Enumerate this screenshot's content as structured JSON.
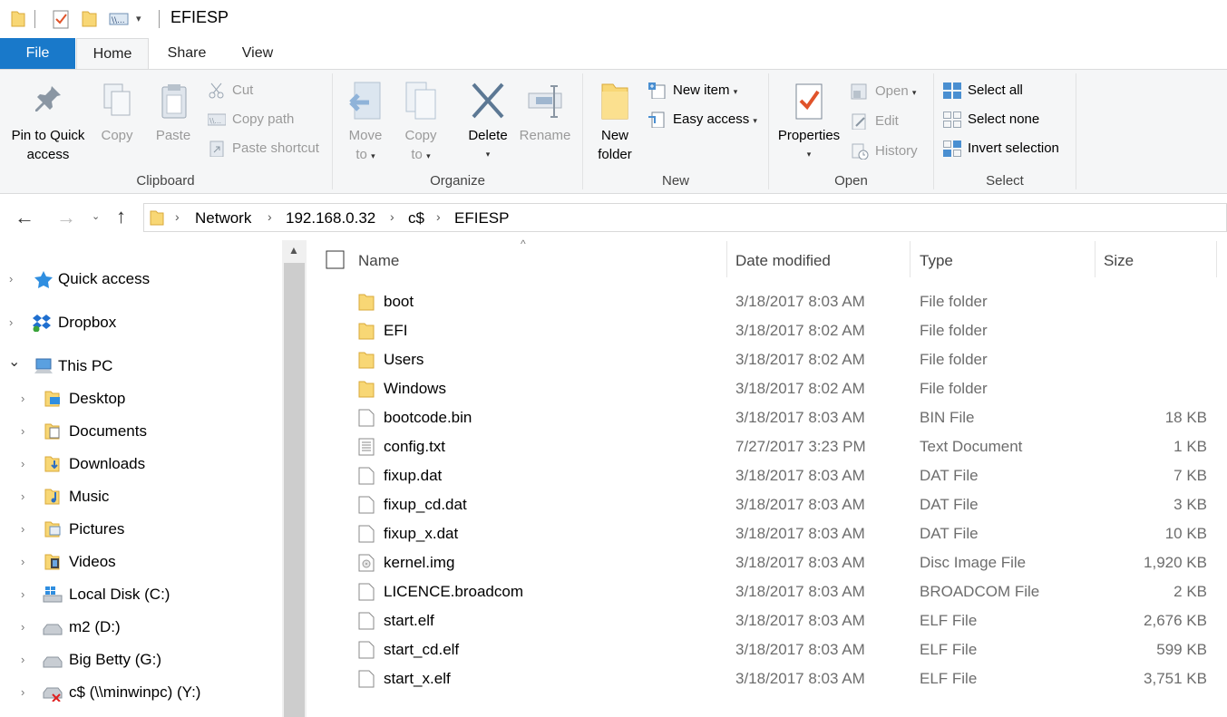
{
  "window": {
    "title": "EFIESP"
  },
  "tabs": [
    "File",
    "Home",
    "Share",
    "View"
  ],
  "ribbon": {
    "clipboard": {
      "group_label": "Clipboard",
      "pin_label_1": "Pin to Quick",
      "pin_label_2": "access",
      "copy": "Copy",
      "paste": "Paste",
      "cut": "Cut",
      "copy_path": "Copy path",
      "paste_shortcut": "Paste shortcut"
    },
    "organize": {
      "group_label": "Organize",
      "move_1": "Move",
      "move_2": "to",
      "copy_1": "Copy",
      "copy_2": "to",
      "delete": "Delete",
      "rename": "Rename"
    },
    "new": {
      "group_label": "New",
      "new_folder_1": "New",
      "new_folder_2": "folder",
      "new_item": "New item",
      "easy_access": "Easy access"
    },
    "open": {
      "group_label": "Open",
      "properties": "Properties",
      "open": "Open",
      "edit": "Edit",
      "history": "History"
    },
    "select": {
      "group_label": "Select",
      "select_all": "Select all",
      "select_none": "Select none",
      "invert": "Invert selection"
    }
  },
  "address": {
    "crumbs": [
      "Network",
      "192.168.0.32",
      "c$",
      "EFIESP"
    ]
  },
  "navpane": {
    "items": [
      {
        "label": "Quick access",
        "expander": "›"
      },
      {
        "label": "Dropbox",
        "expander": "›"
      },
      {
        "label": "This PC",
        "expander": "⌄"
      },
      {
        "label": "Desktop",
        "expander": "›"
      },
      {
        "label": "Documents",
        "expander": "›"
      },
      {
        "label": "Downloads",
        "expander": "›"
      },
      {
        "label": "Music",
        "expander": "›"
      },
      {
        "label": "Pictures",
        "expander": "›"
      },
      {
        "label": "Videos",
        "expander": "›"
      },
      {
        "label": "Local Disk (C:)",
        "expander": "›"
      },
      {
        "label": "m2 (D:)",
        "expander": "›"
      },
      {
        "label": "Big Betty (G:)",
        "expander": "›"
      },
      {
        "label": "c$ (\\\\minwinpc) (Y:)",
        "expander": "›"
      }
    ]
  },
  "columns": {
    "name": "Name",
    "date": "Date modified",
    "type": "Type",
    "size": "Size"
  },
  "files": [
    {
      "name": "boot",
      "date": "3/18/2017 8:03 AM",
      "type": "File folder",
      "size": "",
      "kind": "folder"
    },
    {
      "name": "EFI",
      "date": "3/18/2017 8:02 AM",
      "type": "File folder",
      "size": "",
      "kind": "folder"
    },
    {
      "name": "Users",
      "date": "3/18/2017 8:02 AM",
      "type": "File folder",
      "size": "",
      "kind": "folder"
    },
    {
      "name": "Windows",
      "date": "3/18/2017 8:02 AM",
      "type": "File folder",
      "size": "",
      "kind": "folder"
    },
    {
      "name": "bootcode.bin",
      "date": "3/18/2017 8:03 AM",
      "type": "BIN File",
      "size": "18 KB",
      "kind": "file"
    },
    {
      "name": "config.txt",
      "date": "7/27/2017 3:23 PM",
      "type": "Text Document",
      "size": "1 KB",
      "kind": "text"
    },
    {
      "name": "fixup.dat",
      "date": "3/18/2017 8:03 AM",
      "type": "DAT File",
      "size": "7 KB",
      "kind": "file"
    },
    {
      "name": "fixup_cd.dat",
      "date": "3/18/2017 8:03 AM",
      "type": "DAT File",
      "size": "3 KB",
      "kind": "file"
    },
    {
      "name": "fixup_x.dat",
      "date": "3/18/2017 8:03 AM",
      "type": "DAT File",
      "size": "10 KB",
      "kind": "file"
    },
    {
      "name": "kernel.img",
      "date": "3/18/2017 8:03 AM",
      "type": "Disc Image File",
      "size": "1,920 KB",
      "kind": "disc"
    },
    {
      "name": "LICENCE.broadcom",
      "date": "3/18/2017 8:03 AM",
      "type": "BROADCOM File",
      "size": "2 KB",
      "kind": "file"
    },
    {
      "name": "start.elf",
      "date": "3/18/2017 8:03 AM",
      "type": "ELF File",
      "size": "2,676 KB",
      "kind": "file"
    },
    {
      "name": "start_cd.elf",
      "date": "3/18/2017 8:03 AM",
      "type": "ELF File",
      "size": "599 KB",
      "kind": "file"
    },
    {
      "name": "start_x.elf",
      "date": "3/18/2017 8:03 AM",
      "type": "ELF File",
      "size": "3,751 KB",
      "kind": "file"
    }
  ]
}
